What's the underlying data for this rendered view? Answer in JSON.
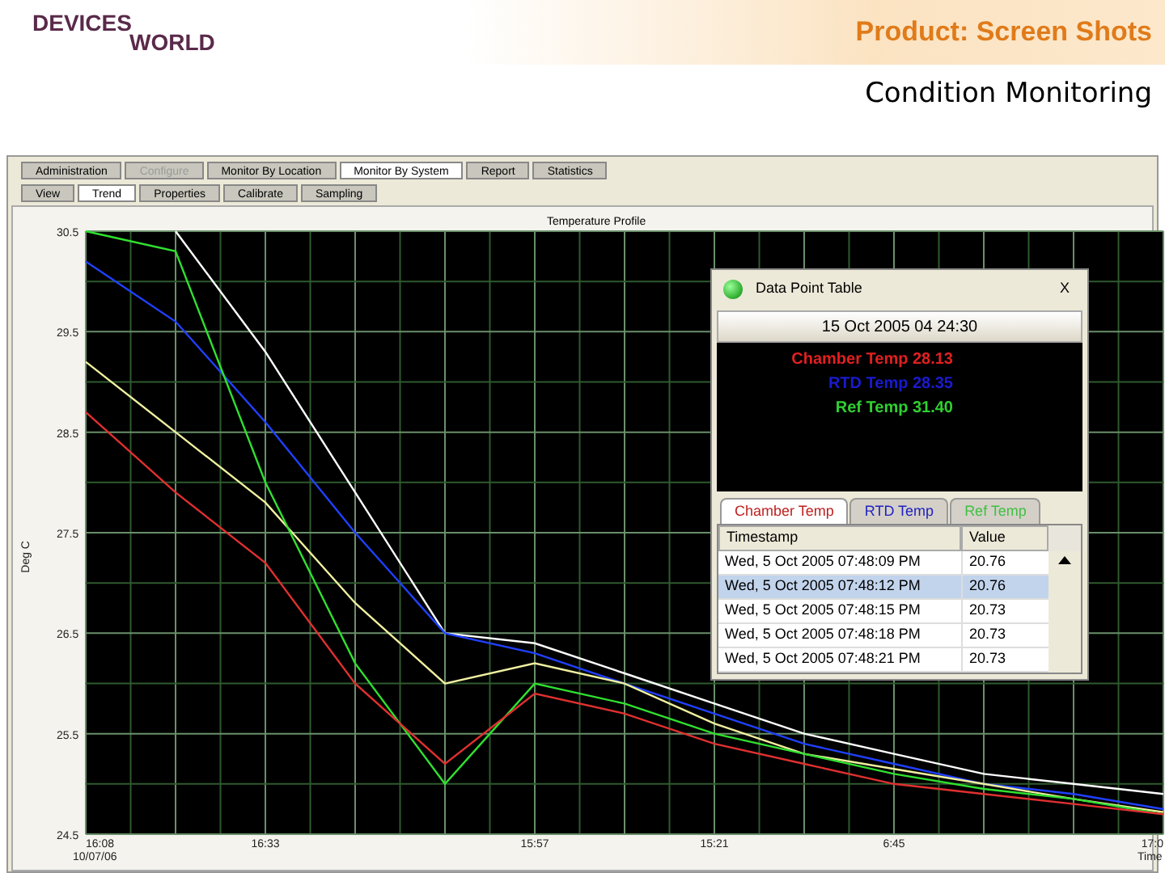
{
  "slide": {
    "logo_top": "DEVICES",
    "logo_bottom": "WORLD",
    "title": "Product: Screen Shots",
    "subtitle": "Condition Monitoring"
  },
  "main_tabs": [
    {
      "label": "Administration",
      "selected": false,
      "disabled": false
    },
    {
      "label": "Configure",
      "selected": false,
      "disabled": true
    },
    {
      "label": "Monitor By Location",
      "selected": false,
      "disabled": false
    },
    {
      "label": "Monitor By System",
      "selected": true,
      "disabled": false
    },
    {
      "label": "Report",
      "selected": false,
      "disabled": false
    },
    {
      "label": "Statistics",
      "selected": false,
      "disabled": false
    }
  ],
  "sub_tabs": [
    {
      "label": "View",
      "selected": false
    },
    {
      "label": "Trend",
      "selected": true
    },
    {
      "label": "Properties",
      "selected": false
    },
    {
      "label": "Calibrate",
      "selected": false
    },
    {
      "label": "Sampling",
      "selected": false
    }
  ],
  "chart": {
    "date_label": "10/07/06",
    "chart_data": {
      "type": "line",
      "title": "Temperature Profile",
      "xlabel": "Time",
      "ylabel": "Deg C",
      "categories": [
        "16:08",
        null,
        "16:33",
        null,
        null,
        "15:57",
        null,
        "15:21",
        null,
        "6:45",
        null,
        null,
        "17:0"
      ],
      "ylim": [
        24.5,
        30.5
      ],
      "grid": true,
      "yticks": [
        24.5,
        25.5,
        26.5,
        27.5,
        28.5,
        29.5,
        30.5
      ],
      "series": [
        {
          "color": "#ffffff",
          "values": [
            null,
            30.5,
            29.3,
            27.9,
            26.5,
            26.4,
            26.1,
            25.8,
            25.5,
            25.3,
            25.1,
            25.0,
            24.9
          ]
        },
        {
          "color": "#2040ff",
          "values": [
            30.2,
            29.6,
            28.6,
            27.5,
            26.5,
            26.3,
            26.0,
            25.7,
            25.4,
            25.2,
            25.0,
            24.9,
            24.75
          ]
        },
        {
          "color": "#f0f0a0",
          "values": [
            29.2,
            28.5,
            27.8,
            26.8,
            26.0,
            26.2,
            26.0,
            25.6,
            25.3,
            25.15,
            25.0,
            24.85,
            24.72
          ]
        },
        {
          "color": "#30e030",
          "values": [
            30.5,
            30.3,
            28.0,
            26.2,
            25.0,
            26.0,
            25.8,
            25.5,
            25.3,
            25.1,
            24.95,
            24.85,
            24.7
          ]
        },
        {
          "color": "#e03030",
          "values": [
            28.7,
            27.9,
            27.2,
            26.0,
            25.2,
            25.9,
            25.7,
            25.4,
            25.2,
            25.0,
            24.9,
            24.8,
            24.7
          ]
        }
      ]
    }
  },
  "data_point_table": {
    "title": "Data Point Table",
    "close": "X",
    "datetime": "15 Oct 2005 04 24:30",
    "readings": [
      {
        "label": "Chamber Temp 28.13",
        "color": "#e02020"
      },
      {
        "label": "RTD Temp 28.35",
        "color": "#1a1ad0"
      },
      {
        "label": "Ref Temp 31.40",
        "color": "#30d030"
      }
    ],
    "tabs": [
      {
        "label": "Chamber Temp",
        "selected": true,
        "color": "#c02020"
      },
      {
        "label": "RTD Temp",
        "selected": false,
        "color": "#2020c0"
      },
      {
        "label": "Ref Temp",
        "selected": false,
        "color": "#40c040"
      }
    ],
    "columns": [
      "Timestamp",
      "Value"
    ],
    "rows": [
      {
        "timestamp": "Wed, 5 Oct 2005 07:48:09 PM",
        "value": "20.76",
        "selected": false
      },
      {
        "timestamp": "Wed, 5 Oct 2005 07:48:12 PM",
        "value": "20.76",
        "selected": true
      },
      {
        "timestamp": "Wed, 5 Oct 2005 07:48:15 PM",
        "value": "20.73",
        "selected": false
      },
      {
        "timestamp": "Wed, 5 Oct 2005 07:48:18 PM",
        "value": "20.73",
        "selected": false
      },
      {
        "timestamp": "Wed, 5 Oct 2005 07:48:21 PM",
        "value": "20.73",
        "selected": false
      }
    ]
  }
}
